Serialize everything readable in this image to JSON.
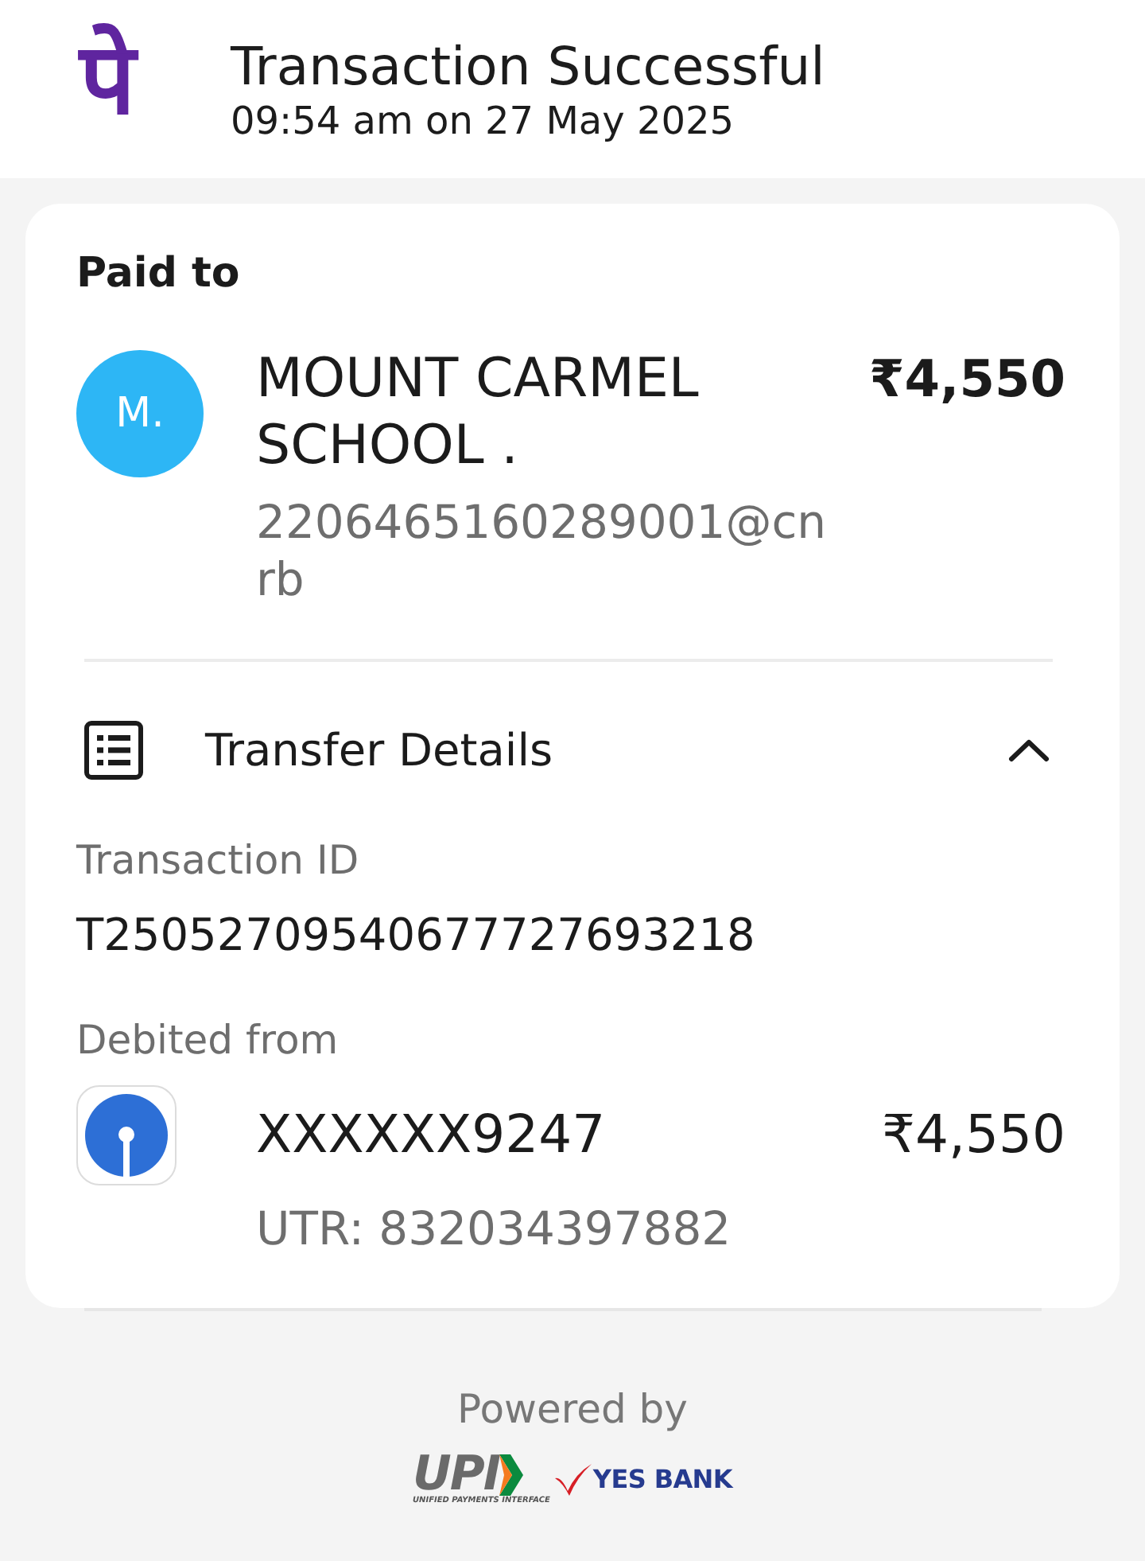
{
  "header": {
    "logo": "पे",
    "title": "Transaction Successful",
    "timestamp": "09:54 am on 27 May 2025"
  },
  "paid_to": {
    "heading": "Paid to",
    "avatar_initials": "M.",
    "name": "MOUNT CARMEL SCHOOL .",
    "upi_id": "2206465160289001@cnrb",
    "amount": "₹4,550"
  },
  "transfer_details": {
    "title": "Transfer Details",
    "expanded": true,
    "fields": [
      {
        "label": "Transaction ID",
        "value": "T25052709540677727693218"
      }
    ],
    "debited_from": {
      "label": "Debited from",
      "account": "XXXXXX9247",
      "amount": "₹4,550",
      "utr": "UTR: 832034397882"
    }
  },
  "footer": {
    "powered_by": "Powered by",
    "upi_logo": "UPI",
    "upi_tagline": "UNIFIED PAYMENTS INTERFACE",
    "bank_logo": "YES BANK"
  }
}
